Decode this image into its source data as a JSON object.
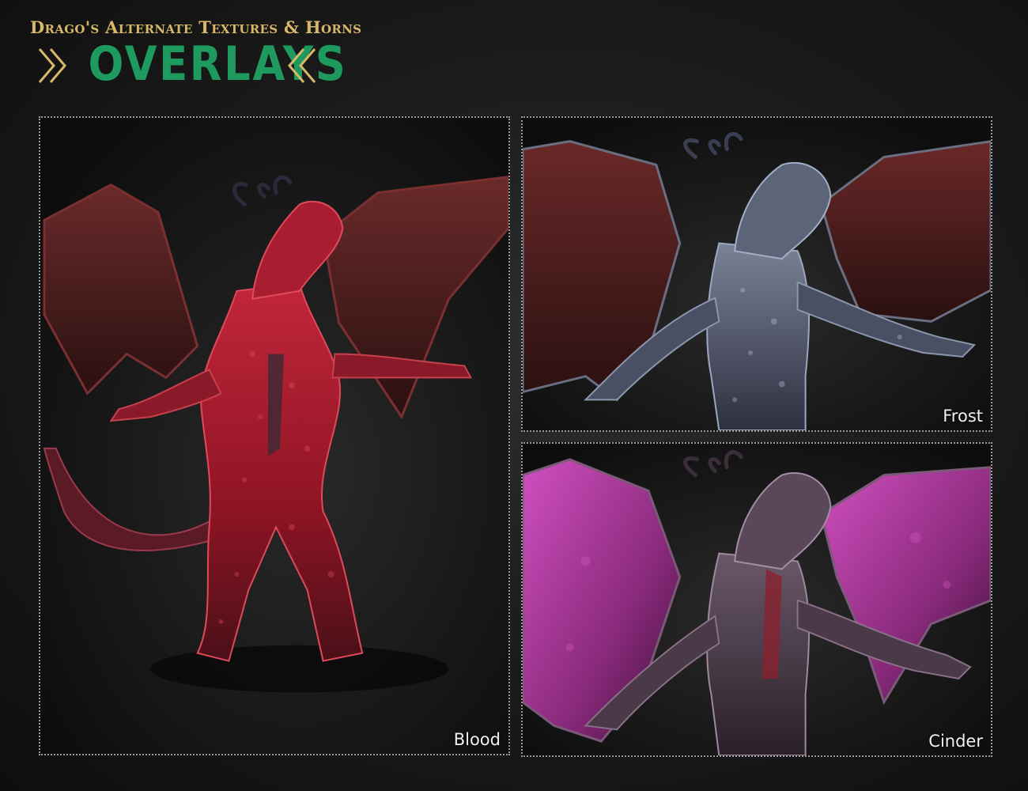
{
  "header": {
    "subtitle": "Drago's Alternate Textures & Horns",
    "title": "OVERLAYS"
  },
  "panels": [
    {
      "label": "Blood",
      "image": "dragon-blood-texture",
      "colors": {
        "body": "#a31628",
        "wing": "#5a2424",
        "accent": "#d23040"
      }
    },
    {
      "label": "Frost",
      "image": "dragon-frost-texture",
      "colors": {
        "body": "#5a6272",
        "wing": "#5a2222",
        "accent": "#9aa8c0"
      }
    },
    {
      "label": "Cinder",
      "image": "dragon-cinder-texture",
      "colors": {
        "body": "#4a3a48",
        "wing": "#b0339a",
        "accent": "#e060c8"
      }
    }
  ],
  "colors": {
    "title_green": "#1e9a5e",
    "subtitle_gold": "#d8b868",
    "background": "#1c1c1c"
  }
}
